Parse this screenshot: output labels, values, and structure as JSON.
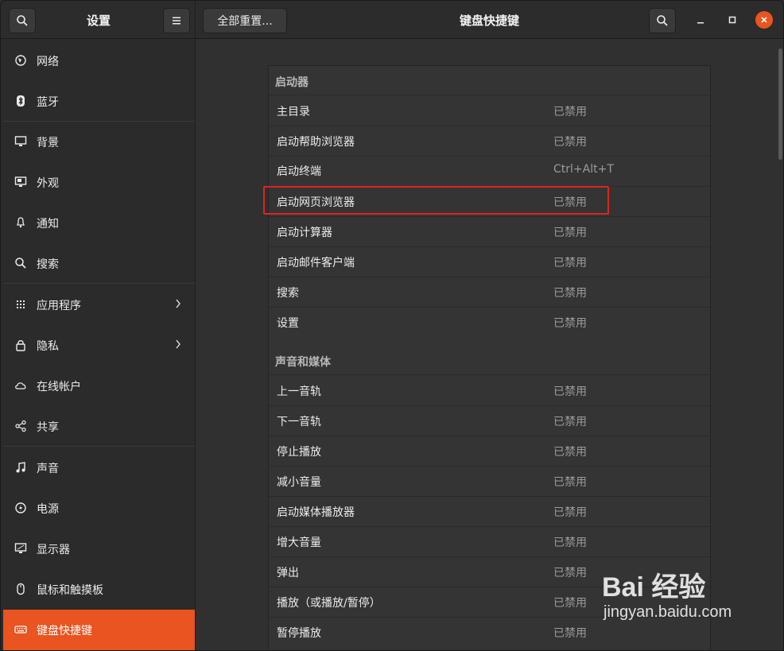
{
  "header": {
    "left_title": "设置",
    "reset_button": "全部重置...",
    "title": "键盘快捷键",
    "accent": "#e95420"
  },
  "sidebar": {
    "items": [
      {
        "label": "网络",
        "icon": "network-icon"
      },
      {
        "label": "蓝牙",
        "icon": "bluetooth-icon"
      },
      {
        "label": "背景",
        "icon": "background-icon"
      },
      {
        "label": "外观",
        "icon": "appearance-icon"
      },
      {
        "label": "通知",
        "icon": "bell-icon"
      },
      {
        "label": "搜索",
        "icon": "search-icon"
      },
      {
        "label": "应用程序",
        "icon": "apps-grid-icon",
        "chevron": true
      },
      {
        "label": "隐私",
        "icon": "lock-icon",
        "chevron": true
      },
      {
        "label": "在线帐户",
        "icon": "cloud-icon"
      },
      {
        "label": "共享",
        "icon": "share-icon"
      },
      {
        "label": "声音",
        "icon": "music-note-icon"
      },
      {
        "label": "电源",
        "icon": "power-icon"
      },
      {
        "label": "显示器",
        "icon": "display-icon"
      },
      {
        "label": "鼠标和触摸板",
        "icon": "mouse-icon"
      },
      {
        "label": "键盘快捷键",
        "icon": "keyboard-icon",
        "active": true
      }
    ]
  },
  "sections": [
    {
      "title": "启动器",
      "rows": [
        {
          "name": "主目录",
          "accel": "已禁用"
        },
        {
          "name": "启动帮助浏览器",
          "accel": "已禁用"
        },
        {
          "name": "启动终端",
          "accel": "Ctrl+Alt+T"
        },
        {
          "name": "启动网页浏览器",
          "accel": "已禁用",
          "highlighted": true
        },
        {
          "name": "启动计算器",
          "accel": "已禁用"
        },
        {
          "name": "启动邮件客户端",
          "accel": "已禁用"
        },
        {
          "name": "搜索",
          "accel": "已禁用"
        },
        {
          "name": "设置",
          "accel": "已禁用"
        }
      ]
    },
    {
      "title": "声音和媒体",
      "rows": [
        {
          "name": "上一音轨",
          "accel": "已禁用"
        },
        {
          "name": "下一音轨",
          "accel": "已禁用"
        },
        {
          "name": "停止播放",
          "accel": "已禁用"
        },
        {
          "name": "减小音量",
          "accel": "已禁用"
        },
        {
          "name": "启动媒体播放器",
          "accel": "已禁用"
        },
        {
          "name": "增大音量",
          "accel": "已禁用"
        },
        {
          "name": "弹出",
          "accel": "已禁用"
        },
        {
          "name": "播放（或播放/暂停）",
          "accel": "已禁用"
        },
        {
          "name": "暂停播放",
          "accel": "已禁用"
        }
      ]
    }
  ],
  "watermark": {
    "line1": "Bai 经验",
    "line2": "jingyan.baidu.com"
  }
}
